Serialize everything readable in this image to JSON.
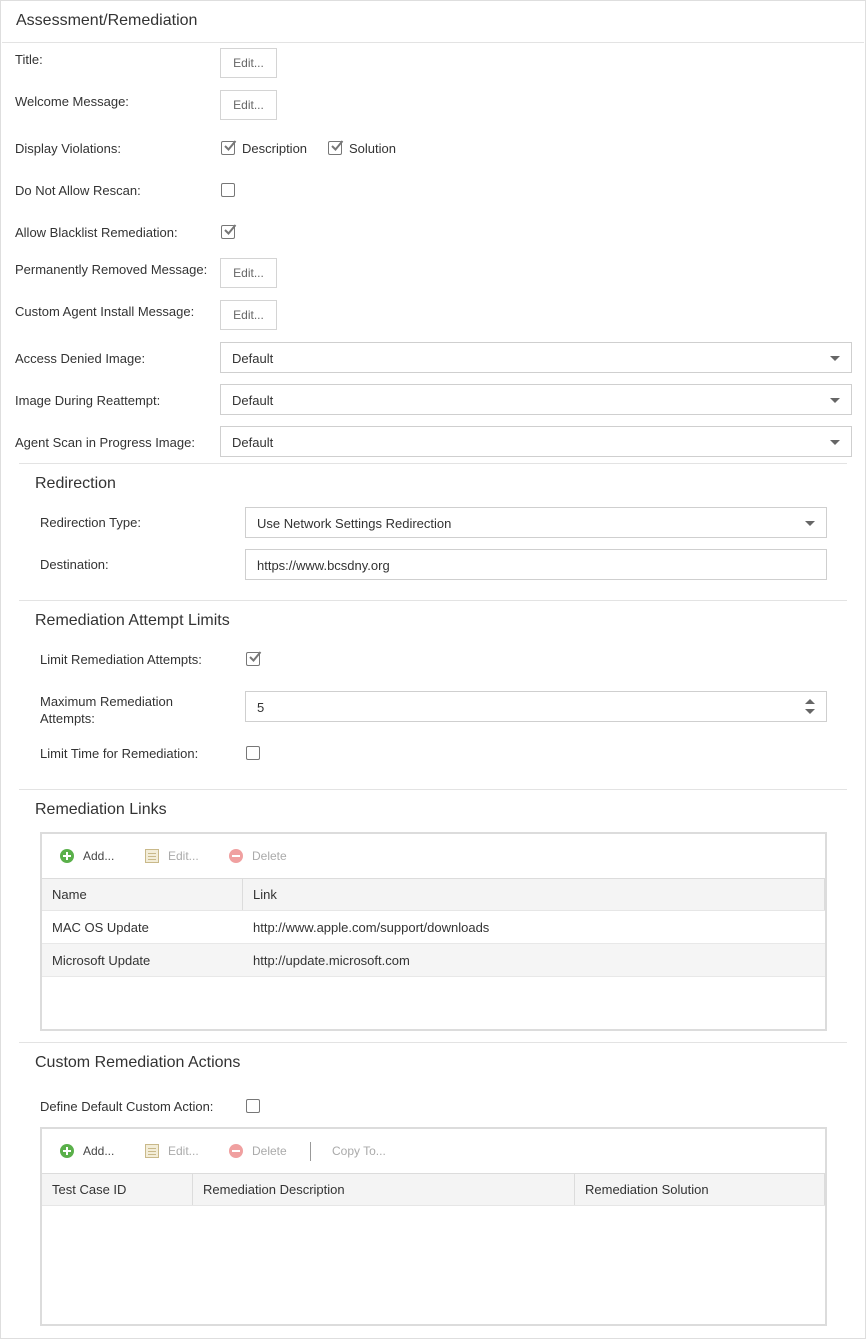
{
  "panel": {
    "title": "Assessment/Remediation"
  },
  "fields": {
    "title": {
      "label": "Title:",
      "button": "Edit..."
    },
    "welcome": {
      "label": "Welcome Message:",
      "button": "Edit..."
    },
    "display_violations": {
      "label": "Display Violations:",
      "options": [
        {
          "label": "Description",
          "checked": true
        },
        {
          "label": "Solution",
          "checked": true
        }
      ]
    },
    "no_rescan": {
      "label": "Do Not Allow Rescan:",
      "checked": false
    },
    "blacklist": {
      "label": "Allow Blacklist Remediation:",
      "checked": true
    },
    "perm_removed": {
      "label": "Permanently Removed Message:",
      "button": "Edit..."
    },
    "custom_agent": {
      "label": "Custom Agent Install Message:",
      "button": "Edit..."
    },
    "access_denied": {
      "label": "Access Denied Image:",
      "value": "Default"
    },
    "reattempt": {
      "label": "Image During Reattempt:",
      "value": "Default"
    },
    "scan_progress": {
      "label": "Agent Scan in Progress Image:",
      "value": "Default"
    }
  },
  "redirection": {
    "title": "Redirection",
    "type_label": "Redirection Type:",
    "type_value": "Use Network Settings Redirection",
    "dest_label": "Destination:",
    "dest_value": "https://www.bcsdny.org"
  },
  "limits": {
    "title": "Remediation Attempt Limits",
    "limit_label": "Limit Remediation Attempts:",
    "limit_checked": true,
    "max_label": "Maximum Remediation Attempts:",
    "max_value": "5",
    "time_label": "Limit Time for Remediation:",
    "time_checked": false
  },
  "links": {
    "title": "Remediation Links",
    "toolbar": {
      "add": "Add...",
      "edit": "Edit...",
      "delete": "Delete"
    },
    "columns": {
      "name": "Name",
      "link": "Link"
    },
    "rows": [
      {
        "name": "MAC OS Update",
        "link": "http://www.apple.com/support/downloads"
      },
      {
        "name": "Microsoft Update",
        "link": "http://update.microsoft.com"
      }
    ]
  },
  "custom": {
    "title": "Custom Remediation Actions",
    "define_label": "Define Default Custom Action:",
    "define_checked": false,
    "toolbar": {
      "add": "Add...",
      "edit": "Edit...",
      "delete": "Delete",
      "copy": "Copy To..."
    },
    "columns": {
      "test_case": "Test Case ID",
      "description": "Remediation Description",
      "solution": "Remediation Solution"
    }
  },
  "colors": {
    "border": "#dedede",
    "add_icon": "#5ab04a",
    "delete_icon": "#f0a0a0",
    "checkmark": "#777777"
  },
  "icons": {
    "add": "add-circle-icon",
    "edit": "edit-notepad-icon",
    "delete": "delete-circle-icon",
    "check": "checkmark-icon",
    "dropdown": "chevron-down-icon"
  }
}
